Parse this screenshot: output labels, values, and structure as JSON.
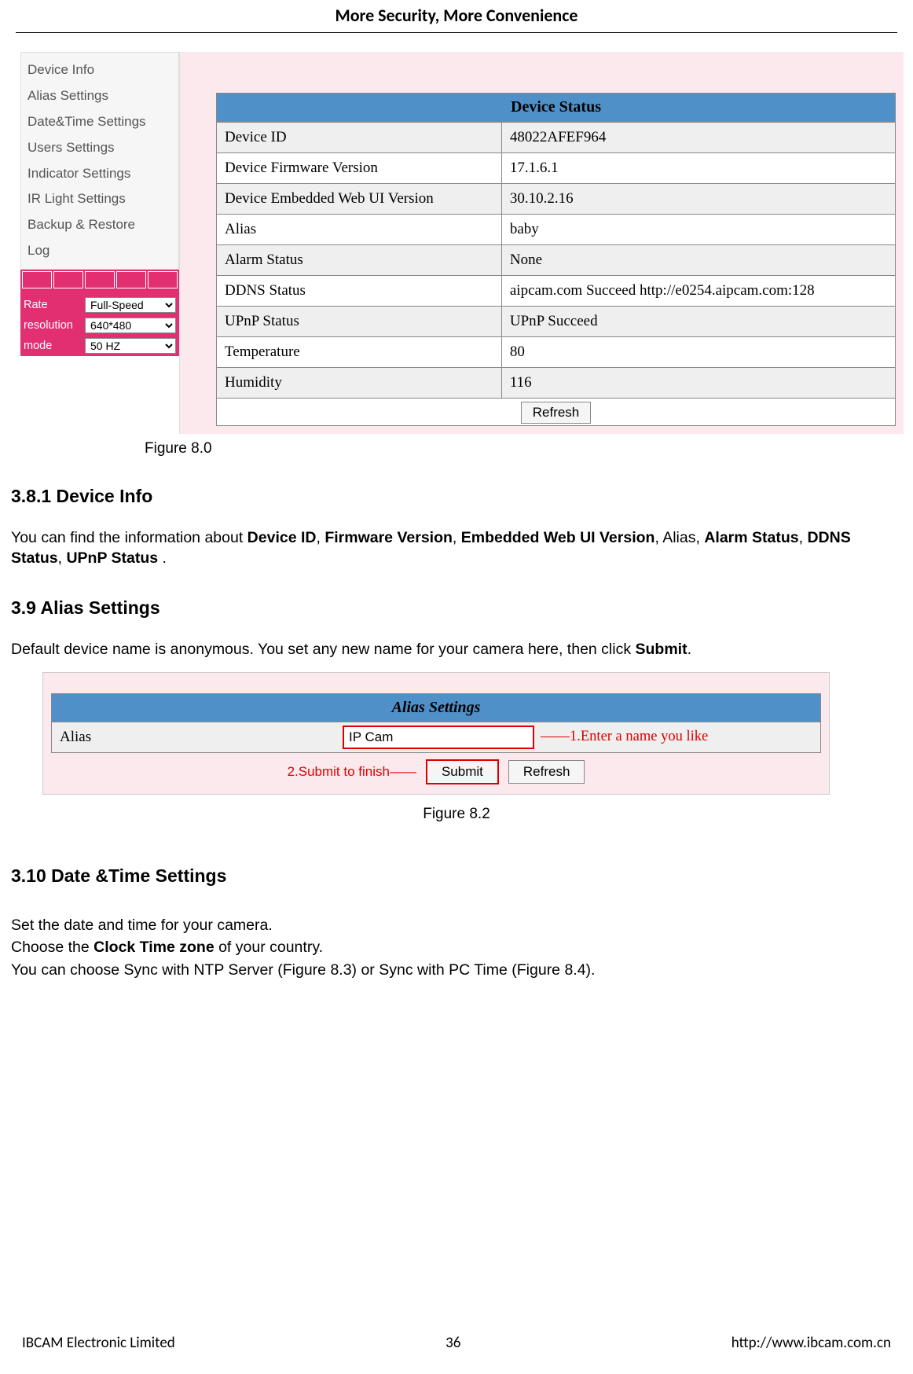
{
  "header": {
    "title": "More Security, More Convenience"
  },
  "fig80": {
    "menu": [
      "Device Info",
      "Alias Settings",
      "Date&Time Settings",
      "Users Settings",
      "Indicator Settings",
      "IR Light Settings",
      "Backup & Restore",
      "Log"
    ],
    "controls": {
      "rate_label": "Rate",
      "rate_value": "Full-Speed",
      "resolution_label": "resolution",
      "resolution_value": "640*480",
      "mode_label": "mode",
      "mode_value": "50 HZ"
    },
    "status_header": "Device Status",
    "rows": [
      {
        "k": "Device ID",
        "v": "48022AFEF964"
      },
      {
        "k": "Device Firmware Version",
        "v": "17.1.6.1"
      },
      {
        "k": "Device Embedded Web UI Version",
        "v": "30.10.2.16"
      },
      {
        "k": "Alias",
        "v": "baby"
      },
      {
        "k": "Alarm Status",
        "v": "None"
      },
      {
        "k": "DDNS Status",
        "v": "aipcam.com  Succeed  http://e0254.aipcam.com:128"
      },
      {
        "k": "UPnP Status",
        "v": "UPnP Succeed"
      },
      {
        "k": "Temperature",
        "v": "80"
      },
      {
        "k": "Humidity",
        "v": "116"
      }
    ],
    "refresh_label": "Refresh",
    "caption": "Figure 8.0"
  },
  "s381": {
    "heading": "3.8.1 Device Info",
    "p_pre": "You can find the information about ",
    "b1": "Device ID",
    "c1": ", ",
    "b2": "Firmware Version",
    "c2": ", ",
    "b3": "Embedded Web UI Version",
    "c3": ", Alias, ",
    "b4": "Alarm Status",
    "c4": ", ",
    "b5": "DDNS Status",
    "c5": ", ",
    "b6": "UPnP Status ",
    "c6": "."
  },
  "s39": {
    "heading": "3.9 Alias Settings",
    "p_pre": "Default device name is anonymous. You set any new name for your camera here, then click ",
    "b1": "Submit",
    "p_post": "."
  },
  "fig82": {
    "header": "Alias Settings",
    "alias_label": "Alias",
    "alias_value": "IP Cam",
    "anno1": "1.Enter a name you like",
    "anno2": "2.Submit to finish",
    "submit_label": "Submit",
    "refresh_label": "Refresh",
    "caption": "Figure 8.2"
  },
  "s310": {
    "heading": "3.10 Date &Time Settings",
    "p1": "Set the date and time for your camera.",
    "p2a": "Choose the ",
    "p2b": "Clock Time zone",
    "p2c": " of your country.",
    "p3": "You can choose Sync with NTP Server (Figure 8.3) or Sync with PC Time (Figure 8.4)."
  },
  "footer": {
    "left": "IBCAM Electronic Limited",
    "center": "36",
    "right": "http://www.ibcam.com.cn"
  }
}
